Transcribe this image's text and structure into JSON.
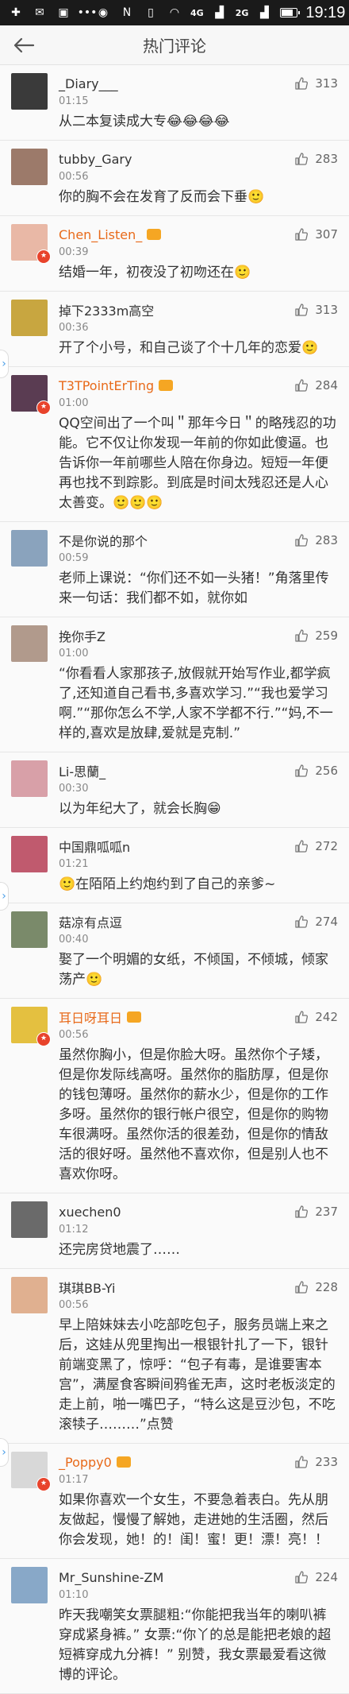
{
  "status_bar": {
    "network_4g": "4G",
    "network_2g": "2G",
    "time": "19:19",
    "battery_level": 0.8
  },
  "header": {
    "title": "热门评论"
  },
  "comments": [
    {
      "name": "_Diary___",
      "time": "01:15",
      "likes": "313",
      "text": "从二本复读成大专😂😂😂😂",
      "avatar_color": "#3a3a3a"
    },
    {
      "name": "tubby_Gary",
      "time": "00:56",
      "likes": "283",
      "text": "你的胸不会在发育了反而会下垂🙂",
      "avatar_color": "#9c7a6a"
    },
    {
      "name": "Chen_Listen_",
      "time": "00:39",
      "likes": "307",
      "text": "结婚一年，初夜没了初吻还在🙂",
      "avatar_color": "#e9b8a6",
      "vip": true
    },
    {
      "name": "掉下2333m高空",
      "time": "00:36",
      "likes": "313",
      "text": "开了个小号，和自己谈了个十几年的恋爱🙂",
      "avatar_color": "#c8a640"
    },
    {
      "name": "T3TPointErTing",
      "time": "01:00",
      "likes": "284",
      "text": "QQ空间出了一个叫＂那年今日＂的略残忍的功能。它不仅让你发现一年前的你如此傻逼。也告诉你一年前哪些人陪在你身边。短短一年便再也找不到踪影。到底是时间太残忍还是人心太善变。🙂🙂🙂",
      "avatar_color": "#5a3c52",
      "vip": true
    },
    {
      "name": "不是你说的那个",
      "time": "00:59",
      "likes": "283",
      "text": "老师上课说：“你们还不如一头猪！”角落里传来一句话：我们都不如，就你如",
      "avatar_color": "#8aa3bd"
    },
    {
      "name": "挽你手Z",
      "time": "01:00",
      "likes": "259",
      "text": "“你看看人家那孩子,放假就开始写作业,都学疯了,还知道自己看书,多喜欢学习.”“我也爱学习啊.”“那你怎么不学,人家不学都不行.”“妈,不一样的,喜欢是放肆,爱就是克制.”",
      "avatar_color": "#b19a8c"
    },
    {
      "name": "Li-思蘭_",
      "time": "00:30",
      "likes": "256",
      "text": "以为年纪大了，就会长胸😁",
      "avatar_color": "#d8a0a8"
    },
    {
      "name": "中国鼎呱呱n",
      "time": "01:21",
      "likes": "272",
      "text": "🙂在陌陌上约炮约到了自己的亲爹~",
      "avatar_color": "#c05a6e"
    },
    {
      "name": "菇凉有点逗",
      "time": "00:40",
      "likes": "274",
      "text": "娶了一个明媚的女纸，不倾国，不倾城，倾家荡产🙂",
      "avatar_color": "#7a8a6a"
    },
    {
      "name": "耳日呀耳日",
      "time": "00:56",
      "likes": "242",
      "text": "虽然你胸小，但是你脸大呀。虽然你个子矮，但是你发际线高呀。虽然你的脂肪厚，但是你的钱包薄呀。虽然你的薪水少，但是你的工作多呀。虽然你的银行帐户很空，但是你的购物车很满呀。虽然你活的很差劲，但是你的情敌活的很好呀。虽然他不喜欢你，但是别人也不喜欢你呀。",
      "avatar_color": "#e4c040",
      "vip": true
    },
    {
      "name": "xuechen0",
      "time": "01:12",
      "likes": "237",
      "text": "还完房贷地震了……",
      "avatar_color": "#6a6a6a"
    },
    {
      "name": "琪琪BB-Yi",
      "time": "00:56",
      "likes": "228",
      "text": "早上陪妹妹去小吃部吃包子，服务员端上来之后，这娃从兜里掏出一根银针扎了一下，银针前端变黑了，惊呼：“包子有毒，是谁要害本宫”，满屋食客瞬间鸦雀无声，这时老板淡定的走上前，啪一嘴巴子，“特么这是豆沙包，不吃滚犊子………”点赞",
      "avatar_color": "#e0b090"
    },
    {
      "name": "_Poppy0",
      "time": "01:17",
      "likes": "233",
      "text": "如果你喜欢一个女生，不要急着表白。先从朋友做起，慢慢了解她，走进她的生活圈，然后 你会发现，她！的！闺！蜜！更！漂！亮！！",
      "avatar_color": "#d8d8d8",
      "vip": true
    },
    {
      "name": "Mr_Sunshine-ZM",
      "time": "01:10",
      "likes": "224",
      "text": "昨天我嘲笑女票腿粗:“你能把我当年的喇叭裤穿成紧身裤。” 女票:“你丫的总是能把老娘的超短裤穿成九分裤！” 别赞，我女票最爱看这微博的评论。",
      "avatar_color": "#88a8c8"
    }
  ],
  "icons": {
    "back": "back-arrow-icon",
    "like": "thumb-up-icon"
  }
}
